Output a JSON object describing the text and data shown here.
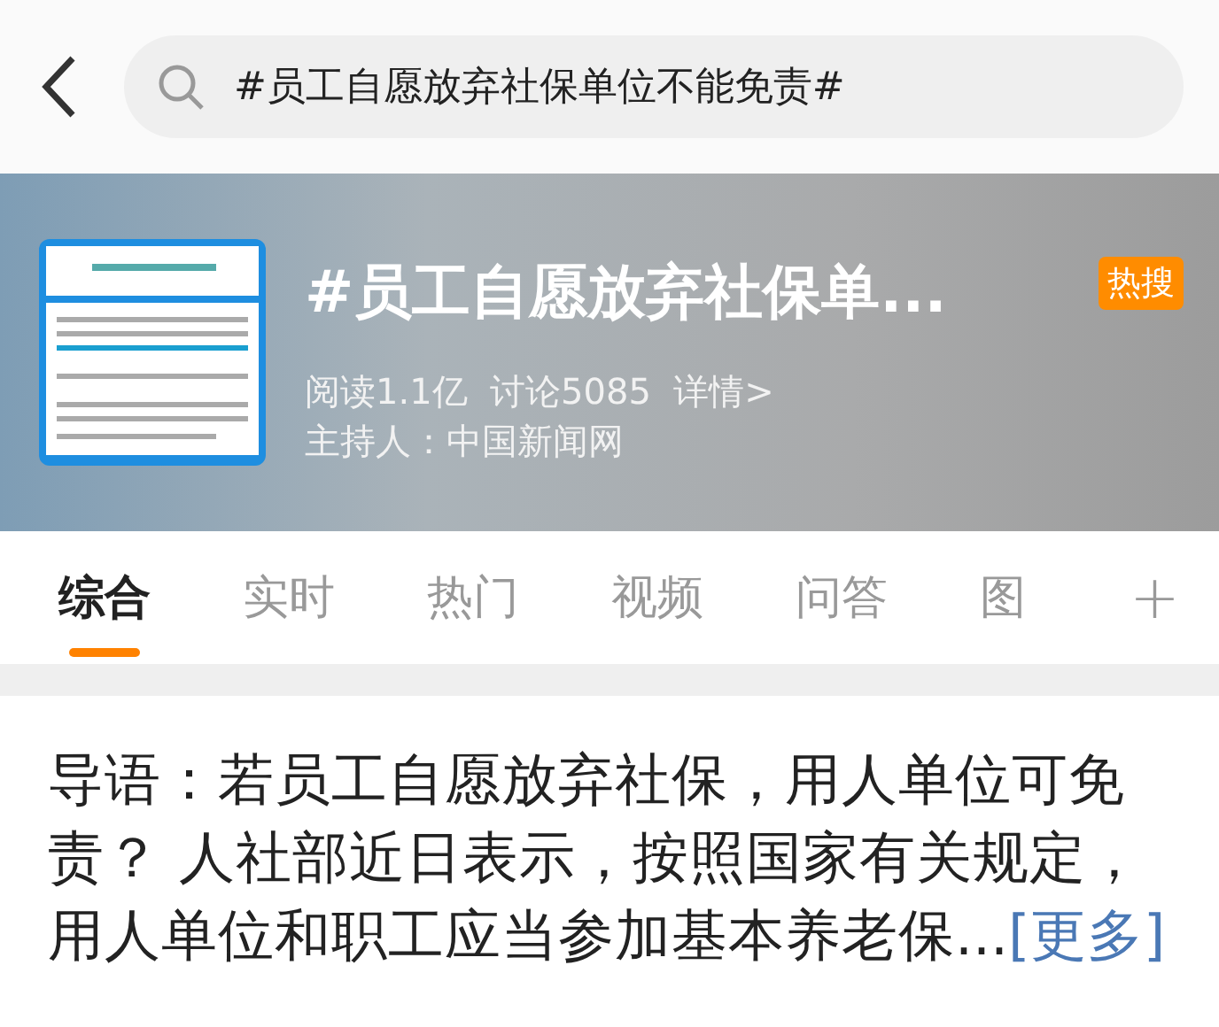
{
  "search": {
    "value": "#员工自愿放弃社保单位不能免责#"
  },
  "topic": {
    "title": "#员工自愿放弃社保单...",
    "badge": "热搜",
    "stats": "阅读1.1亿  讨论5085  详情>",
    "host": "主持人：中国新闻网"
  },
  "tabs": [
    {
      "label": "综合",
      "selected": true
    },
    {
      "label": "实时",
      "selected": false
    },
    {
      "label": "热门",
      "selected": false
    },
    {
      "label": "视频",
      "selected": false
    },
    {
      "label": "问答",
      "selected": false
    },
    {
      "label": "图",
      "selected": false
    }
  ],
  "add_tab": "+",
  "lead": {
    "text": "导语：若员工自愿放弃社保，用人单位可免责？ 人社部近日表示，按照国家有关规定，用人单位和职工应当参加基本养老保...",
    "more": "[更多]"
  }
}
